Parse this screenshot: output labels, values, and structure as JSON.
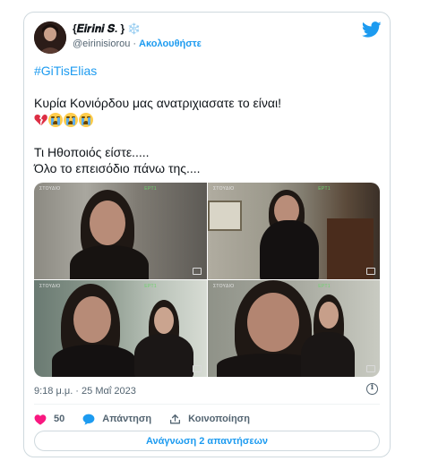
{
  "tweet": {
    "display_name": "{𝑬𝒊𝒓𝒊𝒏𝒊 𝑺. }",
    "snowflake": "❄️",
    "handle": "@eirinisiorou",
    "separator": "·",
    "follow_label": "Ακολουθήστε",
    "hashtag": "#GiTisElias",
    "line1": "Κυρία Κονιόρδου μας ανατριχιασατε το είναι!",
    "line2": "Τι Ηθοποιός είστε.....",
    "line3": "Όλο το επεισόδιο πάνω της....",
    "emojis": [
      "broken-heart",
      "loudly-crying-face",
      "loudly-crying-face",
      "loudly-crying-face"
    ],
    "media": [
      {
        "watermark_left": "ΣΤΟΥΔΙΟ",
        "watermark_right": "ΕΡΤ1"
      },
      {
        "watermark_left": "ΣΤΟΥΔΙΟ",
        "watermark_right": "ΕΡΤ1"
      },
      {
        "watermark_left": "ΣΤΟΥΔΙΟ",
        "watermark_right": "ΕΡΤ1"
      },
      {
        "watermark_left": "ΣΤΟΥΔΙΟ",
        "watermark_right": "ΕΡΤ1"
      }
    ],
    "timestamp": "9:18 μ.μ. · 25 Μαΐ 2023"
  },
  "actions": {
    "likes_count": "50",
    "reply_label": "Απάντηση",
    "share_label": "Κοινοποίηση",
    "read_replies_label": "Ανάγνωση 2 απαντήσεων"
  },
  "colors": {
    "accent": "#1d9bf0",
    "like": "#f91880",
    "muted": "#536471"
  }
}
